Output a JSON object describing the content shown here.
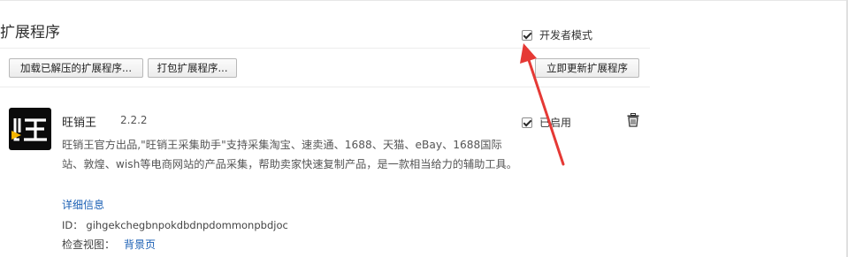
{
  "page": {
    "title": "扩展程序",
    "developer_mode": {
      "label": "开发者模式",
      "checked": true
    }
  },
  "toolbar": {
    "load_unpacked": "加载已解压的扩展程序...",
    "pack_extension": "打包扩展程序...",
    "update_now": "立即更新扩展程序"
  },
  "extension": {
    "name": "旺销王",
    "version": "2.2.2",
    "description": "旺销王官方出品,\"旺销王采集助手\"支持采集淘宝、速卖通、1688、天猫、eBay、1688国际站、敦煌、wish等电商网站的产品采集，帮助卖家快速复制产品，是一款相当给力的辅助工具。",
    "details_link": "详细信息",
    "id_text": "ID： gihgekchegbnpokdbdnpdommonpbdjoc",
    "inspect_label": "检查视图：",
    "inspect_link": "背景页",
    "enabled_label": "已启用",
    "enabled": true,
    "icon": "wangxiaowang-logo-icon",
    "icon_colors": {
      "background": "#0b0b0b",
      "glyph": "#ffffff",
      "accent": "#f4b400"
    }
  },
  "annotation": {
    "type": "arrow",
    "color": "#e53935"
  },
  "colors": {
    "link": "#1a5fb4",
    "divider": "#ececec",
    "text": "#333333"
  }
}
